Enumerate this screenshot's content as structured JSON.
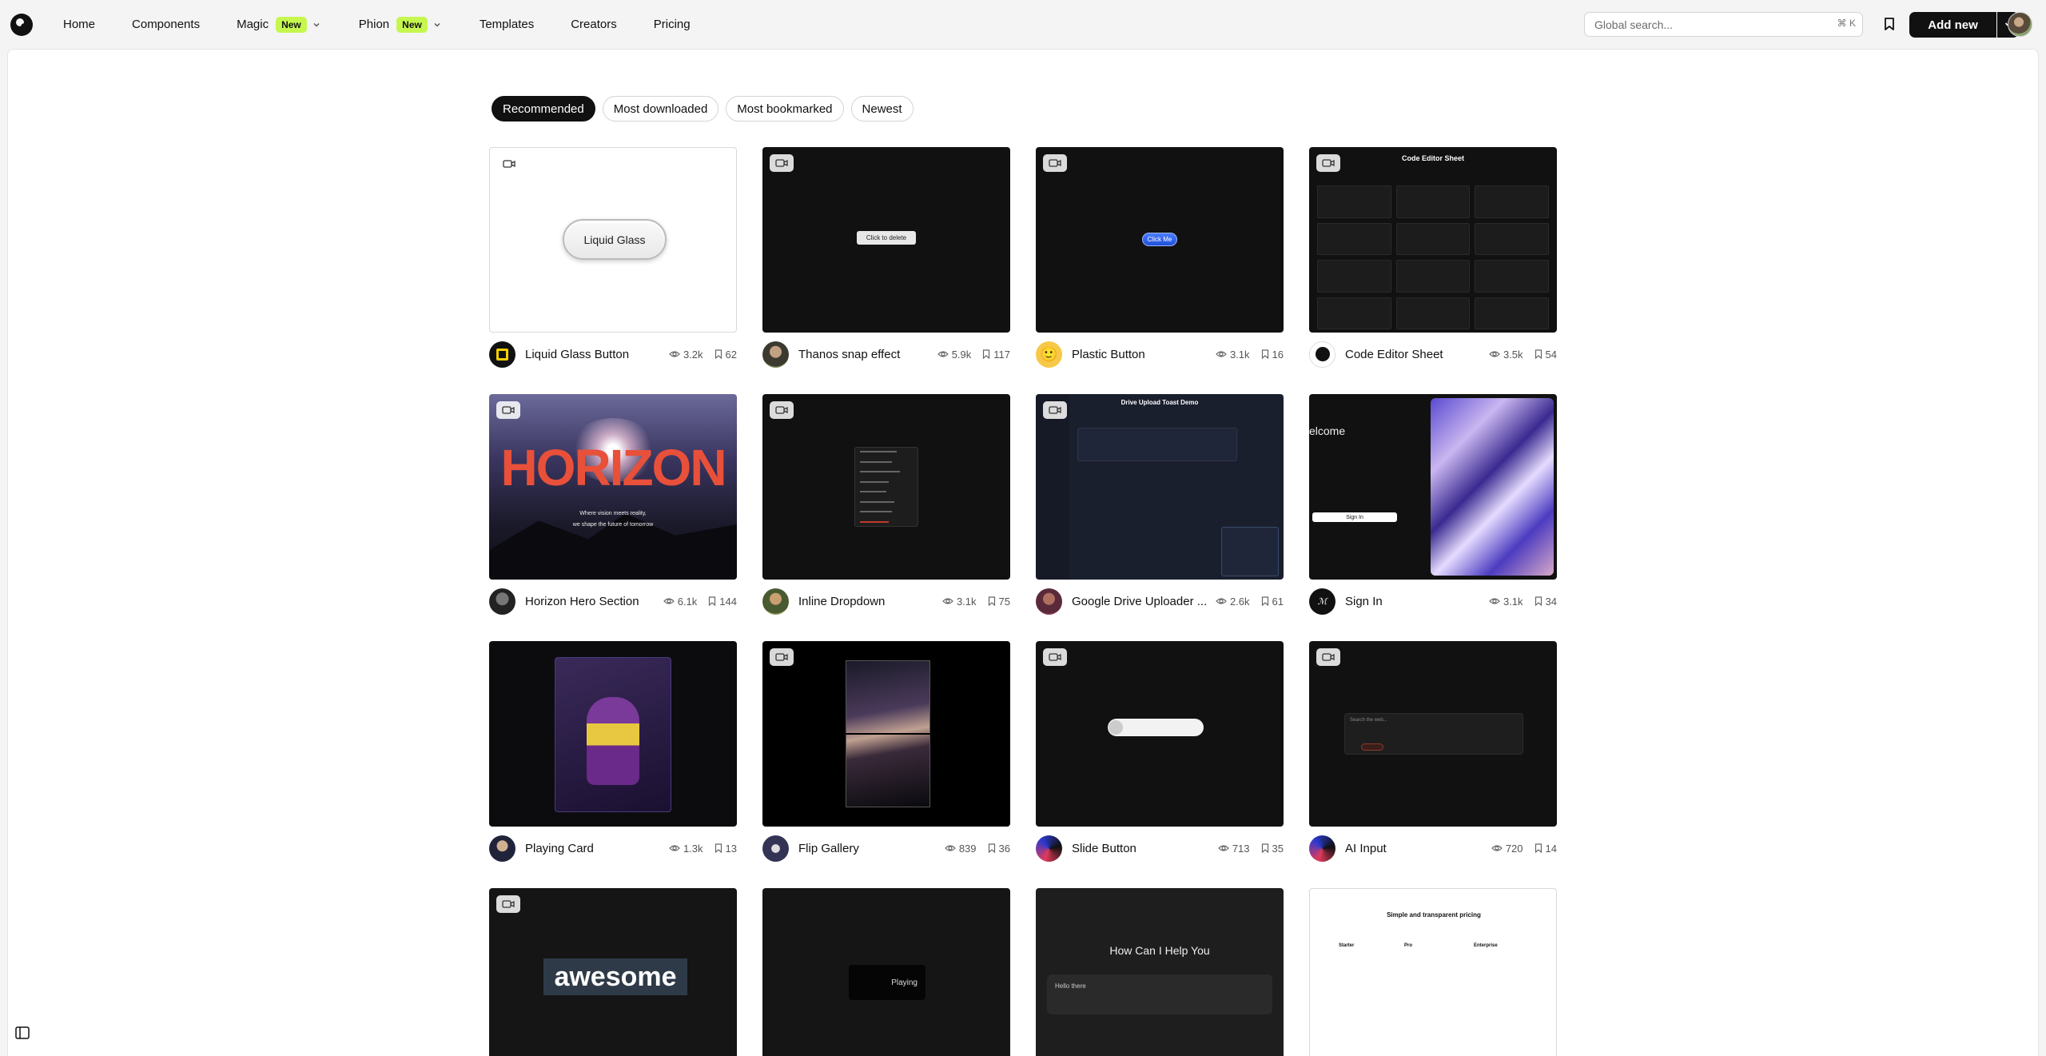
{
  "nav": {
    "items": [
      {
        "label": "Home"
      },
      {
        "label": "Components"
      },
      {
        "label": "Magic",
        "badge": "New"
      },
      {
        "label": "Phion",
        "badge": "New"
      },
      {
        "label": "Templates"
      },
      {
        "label": "Creators"
      },
      {
        "label": "Pricing"
      }
    ],
    "search_placeholder": "Global search...",
    "search_shortcut": "⌘ K",
    "add_new_label": "Add new"
  },
  "filters": {
    "items": [
      "Recommended",
      "Most downloaded",
      "Most bookmarked",
      "Newest"
    ],
    "active": "Recommended"
  },
  "cards": [
    {
      "title": "Liquid Glass Button",
      "views": "3.2k",
      "bookmarks": "62",
      "preview_text": "Liquid Glass"
    },
    {
      "title": "Thanos snap effect",
      "views": "5.9k",
      "bookmarks": "117",
      "preview_text": "Click to delete"
    },
    {
      "title": "Plastic Button",
      "views": "3.1k",
      "bookmarks": "16",
      "preview_text": "Click Me"
    },
    {
      "title": "Code Editor Sheet",
      "views": "3.5k",
      "bookmarks": "54",
      "preview_text": "Code Editor Sheet"
    },
    {
      "title": "Horizon Hero Section",
      "views": "6.1k",
      "bookmarks": "144",
      "preview_text": "HORIZON",
      "preview_sub1": "Where vision meets reality,",
      "preview_sub2": "we shape the future of tomorrow"
    },
    {
      "title": "Inline Dropdown",
      "views": "3.1k",
      "bookmarks": "75"
    },
    {
      "title": "Google Drive Uploader ...",
      "views": "2.6k",
      "bookmarks": "61",
      "preview_text": "Drive Upload Toast Demo"
    },
    {
      "title": "Sign In",
      "views": "3.1k",
      "bookmarks": "34",
      "preview_text": "elcome",
      "preview_btn": "Sign In"
    },
    {
      "title": "Playing Card",
      "views": "1.3k",
      "bookmarks": "13"
    },
    {
      "title": "Flip Gallery",
      "views": "839",
      "bookmarks": "36"
    },
    {
      "title": "Slide Button",
      "views": "713",
      "bookmarks": "35"
    },
    {
      "title": "AI Input",
      "views": "720",
      "bookmarks": "14",
      "preview_text": "Search the web..."
    },
    {
      "preview_text": "awesome"
    },
    {
      "preview_text": "Playing"
    },
    {
      "preview_text": "How Can I Help You",
      "preview_input": "Hello there"
    },
    {
      "preview_text": "Simple and transparent pricing",
      "preview_plans": [
        "Starter",
        "Pro",
        "Enterprise"
      ]
    }
  ],
  "icons": {
    "logo": "logo-icon",
    "bookmark": "bookmark-icon",
    "video": "video-icon",
    "eye": "eye-icon",
    "sidebar": "sidebar-toggle-icon"
  },
  "colors": {
    "badge_new": "#c5f74f",
    "primary": "#111111"
  }
}
